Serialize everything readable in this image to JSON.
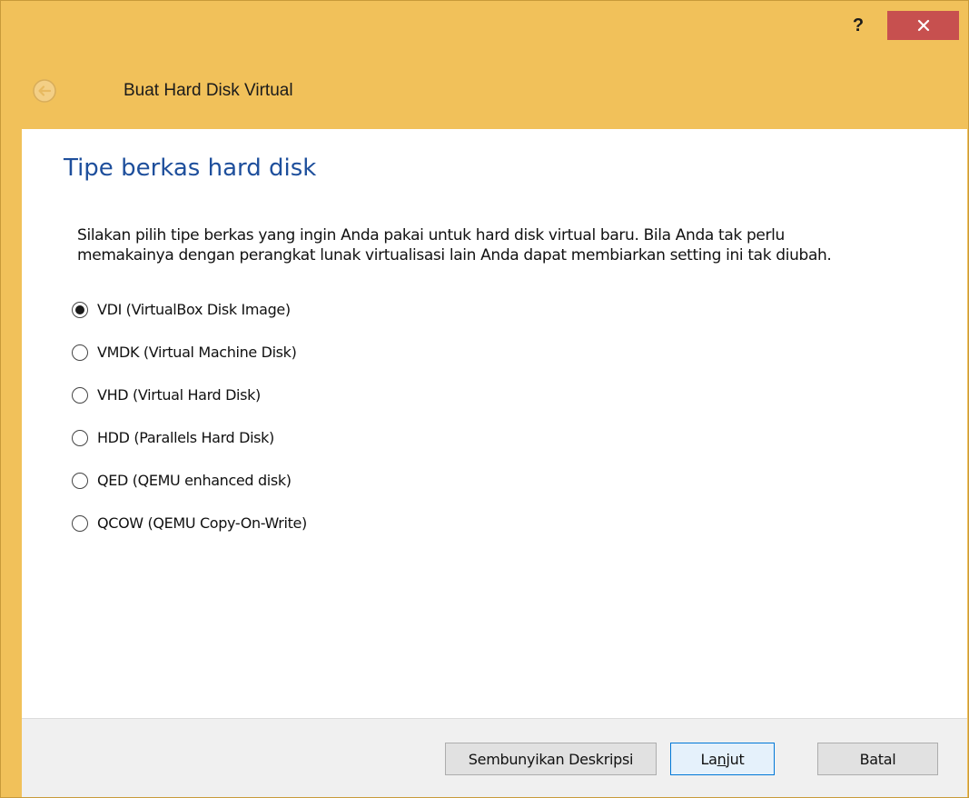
{
  "window": {
    "help_label": "?",
    "close_icon": "close-icon"
  },
  "header": {
    "title": "Buat Hard Disk Virtual",
    "back_icon": "back-arrow-icon"
  },
  "page": {
    "title": "Tipe berkas hard disk",
    "description_line1": "Silakan pilih tipe berkas yang ingin Anda pakai untuk hard disk virtual baru. Bila Anda tak perlu",
    "description_line2": "memakainya dengan perangkat lunak virtualisasi lain Anda dapat membiarkan setting ini tak diubah."
  },
  "options": [
    {
      "label": "VDI (VirtualBox Disk Image)",
      "selected": true
    },
    {
      "label": "VMDK (Virtual Machine Disk)",
      "selected": false
    },
    {
      "label": "VHD (Virtual Hard Disk)",
      "selected": false
    },
    {
      "label": "HDD (Parallels Hard Disk)",
      "selected": false
    },
    {
      "label": "QED (QEMU enhanced disk)",
      "selected": false
    },
    {
      "label": "QCOW (QEMU Copy-On-Write)",
      "selected": false
    }
  ],
  "footer": {
    "hide_description_label": "Sembunyikan Deskripsi",
    "next_label_pre": "La",
    "next_label_accel": "n",
    "next_label_post": "jut",
    "cancel_label": "Batal"
  },
  "colors": {
    "frame": "#f1c15a",
    "close": "#c7504f",
    "title_blue": "#1e4f9c"
  }
}
